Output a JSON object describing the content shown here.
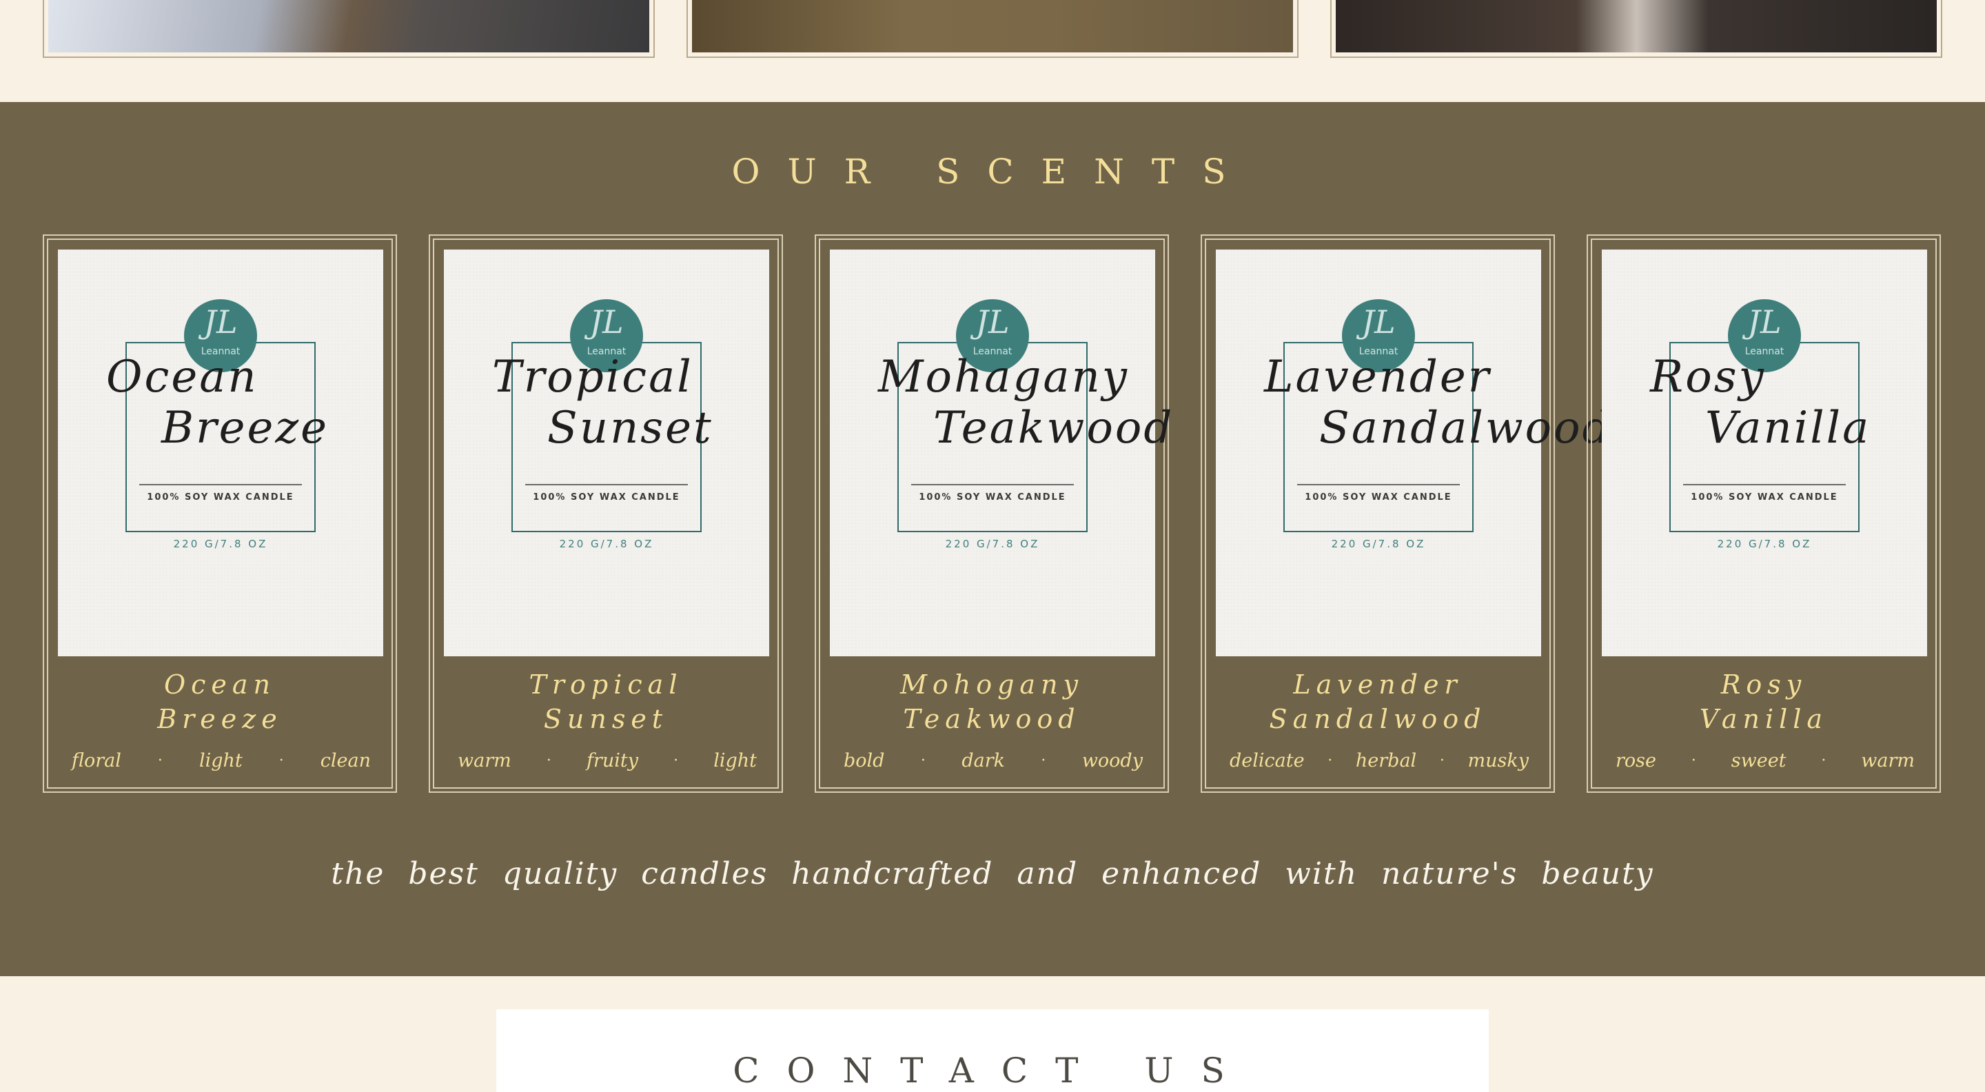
{
  "scents": {
    "title": "OUR SCENTS",
    "tagline": "the best quality candles handcrafted and enhanced with nature's beauty",
    "cards": [
      {
        "label_line1": "Ocean",
        "label_line2": "Breeze",
        "name_line1": "Ocean",
        "name_line2": "Breeze",
        "tags": [
          "floral",
          "light",
          "clean"
        ]
      },
      {
        "label_line1": "Tropical",
        "label_line2": "Sunset",
        "name_line1": "Tropical",
        "name_line2": "Sunset",
        "tags": [
          "warm",
          "fruity",
          "light"
        ]
      },
      {
        "label_line1": "Mohagany",
        "label_line2": "Teakwood",
        "name_line1": "Mohogany",
        "name_line2": "Teakwood",
        "tags": [
          "bold",
          "dark",
          "woody"
        ]
      },
      {
        "label_line1": "Lavender",
        "label_line2": "Sandalwood",
        "name_line1": "Lavender",
        "name_line2": "Sandalwood",
        "tags": [
          "delicate",
          "herbal",
          "musky"
        ]
      },
      {
        "label_line1": "Rosy",
        "label_line2": "Vanilla",
        "name_line1": "Rosy",
        "name_line2": "Vanilla",
        "tags": [
          "rose",
          "sweet",
          "warm"
        ]
      }
    ],
    "label": {
      "logo_monogram": "JL",
      "logo_word": "Leannat",
      "wax": "100% SOY WAX CANDLE",
      "weight": "220 G/7.8 OZ"
    },
    "tag_separator": "·"
  },
  "contact": {
    "title": "CONTACT US"
  },
  "colors": {
    "band": "#6f6349",
    "accent_gold": "#f4df9a",
    "teal": "#3e7f7c",
    "cream": "#f9f1e4"
  }
}
